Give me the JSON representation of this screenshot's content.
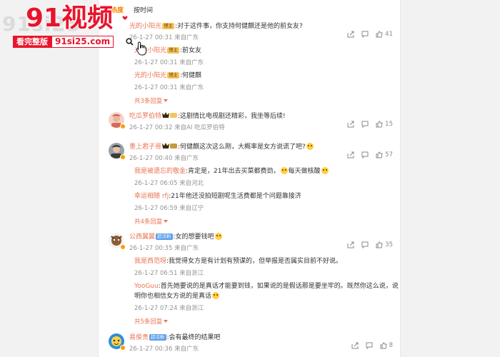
{
  "sort": {
    "hot": "按热度",
    "time": "按时间"
  },
  "watermark": {
    "title": "91视频",
    "bg": "91si25",
    "tagline": "看完整版",
    "url": "91si25.com"
  },
  "comments": [
    {
      "id": "c1",
      "user": "光的小阳光",
      "badge": "博主",
      "text": ":对于这件事，你支持何健麒还是他的前女友?",
      "meta": "26-1-27 00:31 来自广东",
      "likes": "41",
      "show_avatar": false,
      "replies": [
        {
          "user": "光的小阳光",
          "badge": "博主",
          "text": ":前女友",
          "meta": "26-1-27 00:31 来自广东"
        },
        {
          "user": "光的小阳光",
          "badge": "博主",
          "text": ":何健麒",
          "meta": "26-1-27 00:31 来自广东"
        }
      ],
      "more": "共3条回复"
    },
    {
      "id": "c2",
      "user": "吃瓜罗伯特",
      "badge": "",
      "text": ":这剧情比电视剧还精彩，我坐等后续!",
      "meta": "26-1-27 00:32 来自AI 吃瓜罗伯特",
      "likes": "15",
      "replies": [],
      "more": ""
    },
    {
      "id": "c3",
      "user": "墨上君子哥",
      "badge": "",
      "text": ":何健麒这次这么刚，大概率是女方说谎了吧?",
      "meta": "26-1-27 00:40 来自广东",
      "likes": "57",
      "replies": [
        {
          "user": "我是被遗忘的敬金",
          "badge": "",
          "text": ":肯定是，21年出去买菜都费劲，",
          "text2": "每天做核酸",
          "meta": "26-1-27 06:05 来自河北"
        },
        {
          "user": "幸运相随 rfj",
          "badge": "",
          "text": ":21年他还没拍短剧呢生活费都是个问题靠接济",
          "meta": "26-1-27 06:59 来自辽宁"
        }
      ],
      "more": "共4条回复"
    },
    {
      "id": "c4",
      "user": "公西翼翼",
      "badge": "超话粉",
      "text": ":女的想要钱吧",
      "meta": "26-1-27 00:35 来自广东",
      "likes": "35",
      "replies": [
        {
          "user": "我是西范呀",
          "badge": "",
          "text": ":我觉得女方是有计划有预谋的，但举报是否属实目前不好说。",
          "meta": "26-1-27 06:51 来自浙江"
        },
        {
          "user": "YooGuu",
          "badge": "",
          "text": ":首先她要说的是真话才能要到钱，如果说的是假话那是要坐牢的。既然你这么说，说",
          "text_line2": "明你也相信女方说的是真话",
          "meta": "26-1-27 07:24 来自浙江"
        }
      ],
      "more": "共5条回复"
    },
    {
      "id": "c5",
      "user": "易俊贵",
      "badge": "超话粉",
      "text": ":会有最终的结果吧",
      "meta": "26-1-27 00:36 来自广东",
      "likes": "8",
      "replies": [],
      "more": ""
    }
  ],
  "colors": {
    "username": "#eb7350",
    "meta": "#939393",
    "brand_red": "#e8142c"
  }
}
